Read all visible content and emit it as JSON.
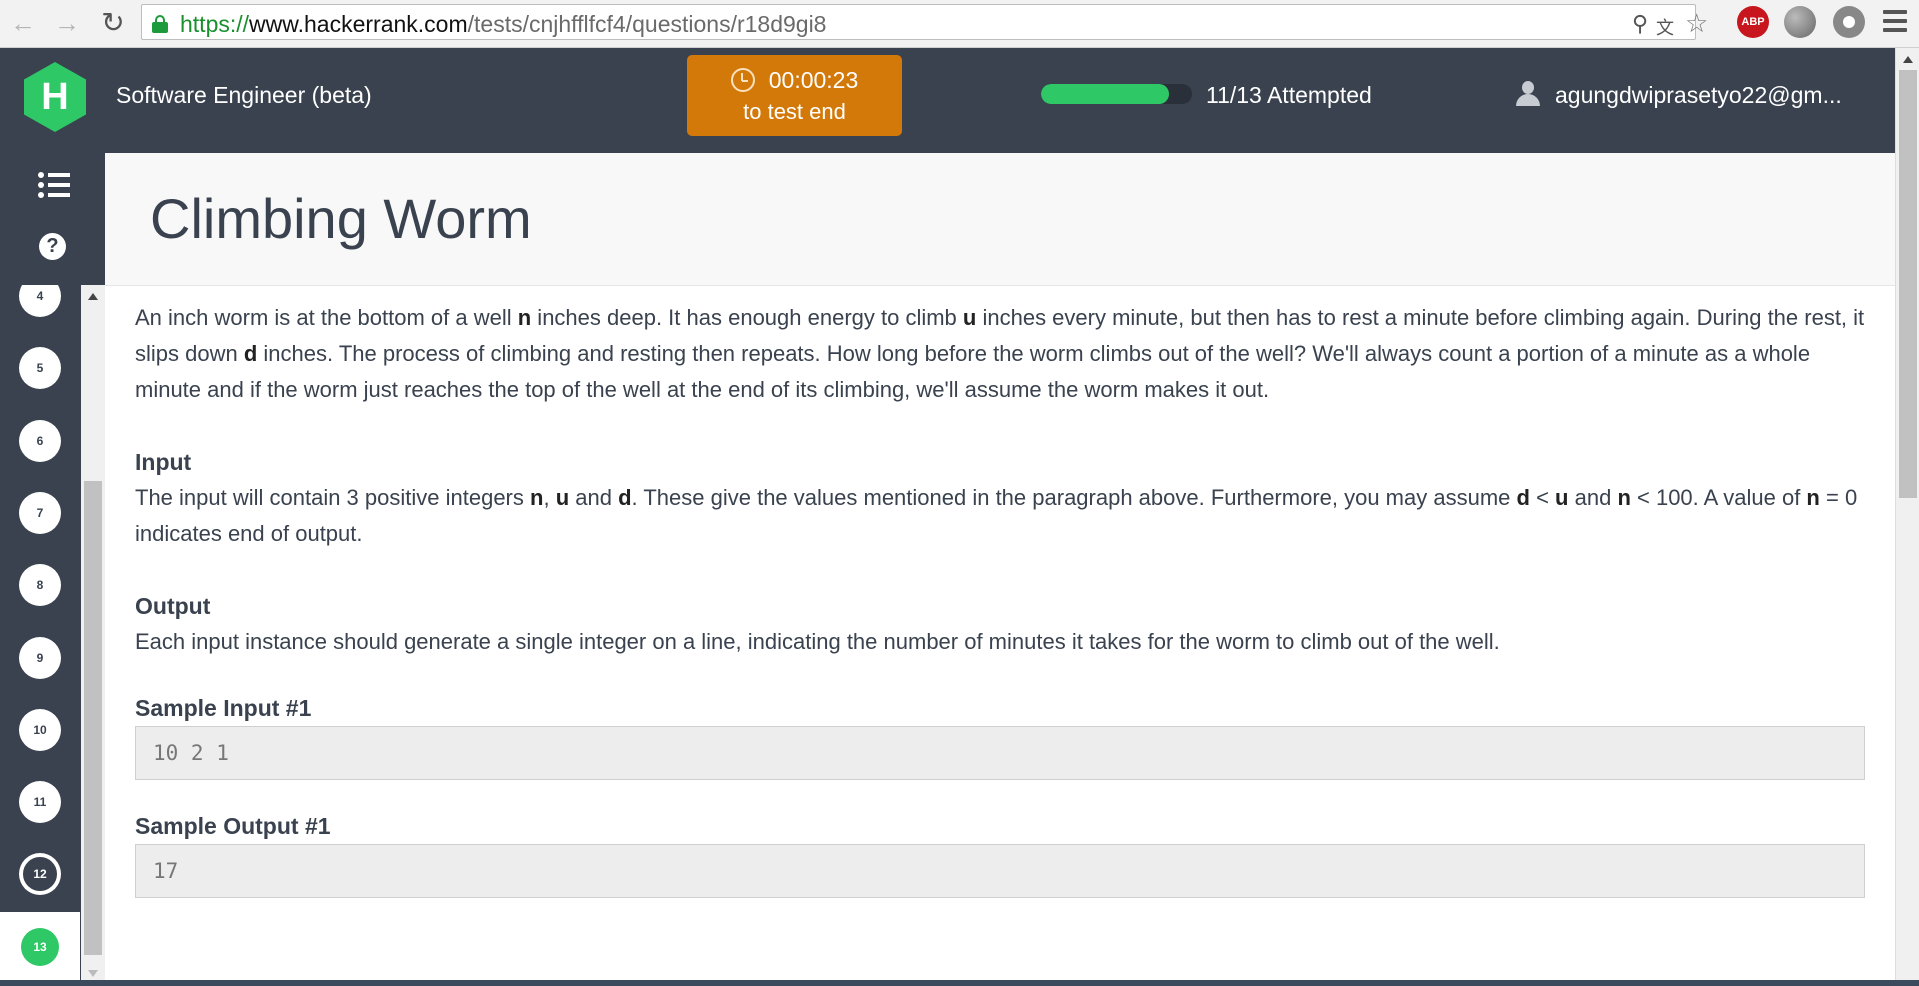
{
  "browser": {
    "url_protocol": "https://",
    "url_host": "www.hackerrank.com",
    "url_path": "/tests/cnjhfflfcf4/questions/r18d9gi8",
    "extension_abp_label": "ABP"
  },
  "header": {
    "logo_letter": "H",
    "test_name": "Software Engineer (beta)",
    "timer_value": "00:00:23",
    "timer_caption": "to test end",
    "progress_fraction": 0.846,
    "attempted_text": "11/13 Attempted",
    "user_email": "agungdwiprasetyo22@gm...",
    "colors": {
      "header_bg": "#39424e",
      "timer_bg": "#d27909",
      "progress": "#2ec866"
    }
  },
  "sidebar": {
    "help_label": "?",
    "questions": [
      {
        "number": "4",
        "state": "filled"
      },
      {
        "number": "5",
        "state": "filled"
      },
      {
        "number": "6",
        "state": "filled"
      },
      {
        "number": "7",
        "state": "filled"
      },
      {
        "number": "8",
        "state": "filled"
      },
      {
        "number": "9",
        "state": "filled"
      },
      {
        "number": "10",
        "state": "filled"
      },
      {
        "number": "11",
        "state": "filled"
      },
      {
        "number": "12",
        "state": "ring"
      },
      {
        "number": "13",
        "state": "current"
      }
    ]
  },
  "question": {
    "title": "Climbing Worm",
    "intro": [
      {
        "t": "An inch worm is at the bottom of a well "
      },
      {
        "b": "n"
      },
      {
        "t": " inches deep. It has enough energy to climb "
      },
      {
        "b": "u"
      },
      {
        "t": " inches every minute, but then has to rest a minute before climbing again. During the rest, it slips down "
      },
      {
        "b": "d"
      },
      {
        "t": " inches. The process of climbing and resting then repeats. How long before the worm climbs out of the well? We'll always count a portion of a minute as a whole minute and if the worm just reaches the top of the well at the end of its climbing, we'll assume the worm makes it out."
      }
    ],
    "input_heading": "Input",
    "input_text": [
      {
        "t": "The input will contain 3 positive integers "
      },
      {
        "b": "n"
      },
      {
        "t": ", "
      },
      {
        "b": "u"
      },
      {
        "t": " and "
      },
      {
        "b": "d"
      },
      {
        "t": ". These give the values mentioned in the paragraph above. Furthermore, you may assume "
      },
      {
        "b": "d"
      },
      {
        "t": " < "
      },
      {
        "b": "u"
      },
      {
        "t": " and "
      },
      {
        "b": "n"
      },
      {
        "t": " < 100. A value of "
      },
      {
        "b": "n"
      },
      {
        "t": " = 0 indicates end of output."
      }
    ],
    "output_heading": "Output",
    "output_text": "Each input instance should generate a single integer on a line, indicating the number of minutes it takes for the worm to climb out of the well.",
    "sample_input_heading": "Sample Input #1",
    "sample_input": "10 2 1",
    "sample_output_heading": "Sample Output #1",
    "sample_output": "17"
  }
}
